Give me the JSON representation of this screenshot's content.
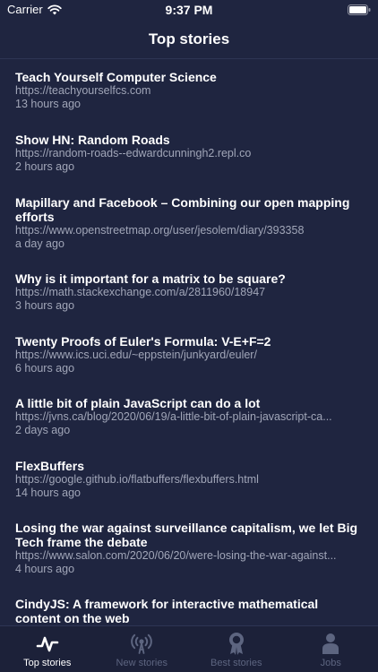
{
  "status_bar": {
    "carrier": "Carrier",
    "time": "9:37 PM"
  },
  "nav": {
    "title": "Top stories"
  },
  "stories": [
    {
      "title": "Teach Yourself Computer Science",
      "url": "https://teachyourselfcs.com",
      "time": "13 hours ago"
    },
    {
      "title": "Show HN: Random Roads",
      "url": "https://random-roads--edwardcunningh2.repl.co",
      "time": "2 hours ago"
    },
    {
      "title": "Mapillary and Facebook – Combining our open mapping efforts",
      "url": "https://www.openstreetmap.org/user/jesolem/diary/393358",
      "time": "a day ago"
    },
    {
      "title": "Why is it important for a matrix to be square?",
      "url": "https://math.stackexchange.com/a/2811960/18947",
      "time": "3 hours ago"
    },
    {
      "title": "Twenty Proofs of Euler's Formula: V-E+F=2",
      "url": "https://www.ics.uci.edu/~eppstein/junkyard/euler/",
      "time": "6 hours ago"
    },
    {
      "title": "A little bit of plain JavaScript can do a lot",
      "url": "https://jvns.ca/blog/2020/06/19/a-little-bit-of-plain-javascript-ca...",
      "time": "2 days ago"
    },
    {
      "title": "FlexBuffers",
      "url": "https://google.github.io/flatbuffers/flexbuffers.html",
      "time": "14 hours ago"
    },
    {
      "title": "Losing the war against surveillance capitalism, we let Big Tech frame the debate",
      "url": "https://www.salon.com/2020/06/20/were-losing-the-war-against...",
      "time": "4 hours ago"
    },
    {
      "title": "CindyJS: A framework for interactive mathematical content on the web",
      "url": "",
      "time": ""
    }
  ],
  "tabs": [
    {
      "label": "Top stories",
      "icon": "pulse-icon",
      "active": true
    },
    {
      "label": "New stories",
      "icon": "broadcast-icon",
      "active": false
    },
    {
      "label": "Best stories",
      "icon": "award-icon",
      "active": false
    },
    {
      "label": "Jobs",
      "icon": "person-icon",
      "active": false
    }
  ],
  "colors": {
    "background": "#1f2540",
    "secondary_text": "#a1a6b8",
    "inactive_tab": "#5d6580"
  }
}
